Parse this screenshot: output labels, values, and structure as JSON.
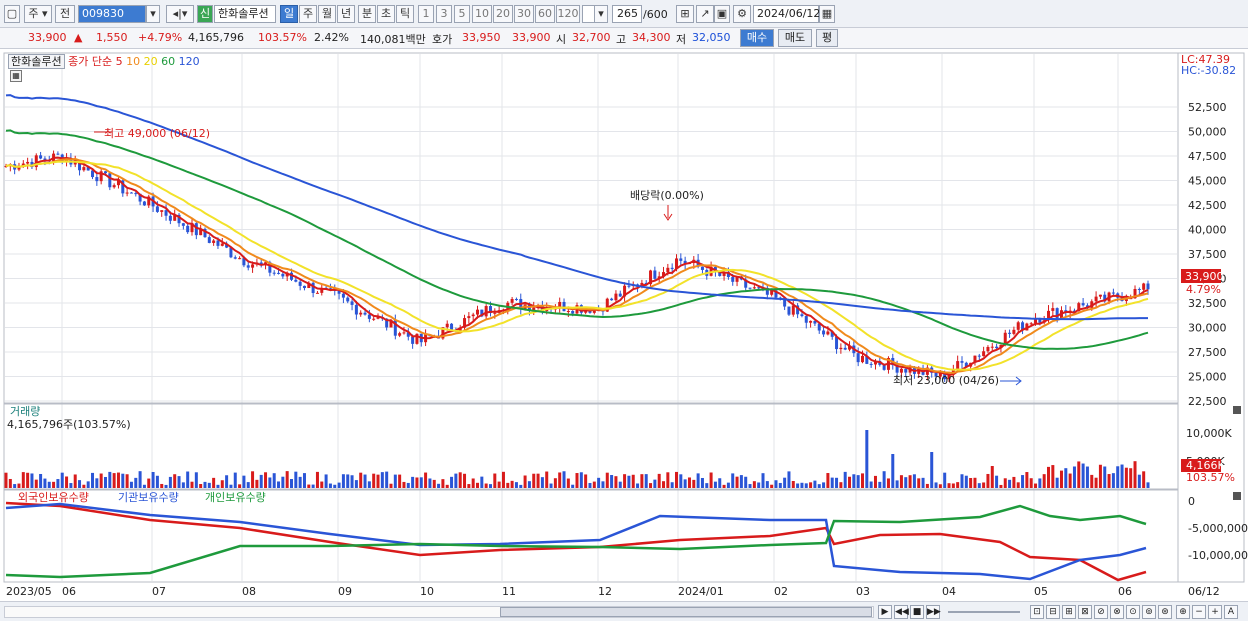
{
  "toolbar": {
    "market": "주",
    "prev": "전",
    "code": "009830",
    "credit": "신",
    "stock_name": "한화솔루션",
    "periods": [
      "일",
      "주",
      "월",
      "년",
      "분",
      "초",
      "틱"
    ],
    "active_period": "일",
    "nums": [
      "1",
      "3",
      "5",
      "10",
      "20",
      "30",
      "60",
      "120"
    ],
    "count": "265",
    "total": "/600",
    "date": "2024/06/12"
  },
  "priceline": {
    "price": "33,900",
    "change": "1,550",
    "change_pct": "+4.79%",
    "volume": "4,165,796",
    "vol_ratio": "103.57%",
    "turnover": "2.42%",
    "amount": "140,081백만",
    "quote_label": "호가",
    "ask": "33,950",
    "bid": "33,900",
    "open_label": "시",
    "open": "32,700",
    "high_label": "고",
    "high": "34,300",
    "low_label": "저",
    "low": "32,050",
    "buy": "매수",
    "sell": "매도",
    "eval": "평"
  },
  "legend": {
    "name": "한화솔루션",
    "ma_label": "종가 단순",
    "ma_periods": [
      "5",
      "10",
      "20",
      "60",
      "120"
    ],
    "ma_colors": [
      "#d81b1b",
      "#f08a1c",
      "#f2e22a",
      "#1e9a3c",
      "#2a55d6"
    ],
    "lc": "LC:47.39",
    "hc": "HC:-30.82"
  },
  "annotations": {
    "high": "최고 49,000 (06/12)",
    "dividend": "배당락(0.00%)",
    "low": "최저 23,000 (04/26)"
  },
  "volume_panel": {
    "title": "거래량",
    "value": "4,165,796주(103.57%)",
    "ticks": [
      "10,000K",
      "5,000K"
    ],
    "last_value": "4,166K",
    "last_pct": "103.57%"
  },
  "holding_panel": {
    "legend": [
      "외국인보유수량",
      "기관보유수량",
      "개인보유수량"
    ],
    "colors": [
      "#d81b1b",
      "#2a55d6",
      "#1e9a3c"
    ],
    "ticks": [
      "0",
      "-5,000,000",
      "-10,000,00"
    ]
  },
  "x_axis": {
    "labels": [
      "2023/05",
      "06",
      "07",
      "08",
      "09",
      "10",
      "11",
      "12",
      "2024/01",
      "02",
      "03",
      "04",
      "05",
      "06",
      "06/12"
    ]
  },
  "chart_data": {
    "type": "line",
    "title": "",
    "y_ticks": [
      "52,500",
      "50,000",
      "47,500",
      "45,000",
      "42,500",
      "40,000",
      "37,500",
      "35,000",
      "32,500",
      "30,000",
      "27,500",
      "25,000",
      "22,500"
    ],
    "last_price": "33,900",
    "last_pct": "4.79%",
    "close_monthly": [
      {
        "x": "2023/05",
        "close": 46500
      },
      {
        "x": "06",
        "close": 47500
      },
      {
        "x": "07",
        "close": 42500
      },
      {
        "x": "08",
        "close": 37000
      },
      {
        "x": "09",
        "close": 33000
      },
      {
        "x": "10",
        "close": 28500
      },
      {
        "x": "11",
        "close": 32500
      },
      {
        "x": "12",
        "close": 32000
      },
      {
        "x": "2024/01",
        "close": 37000
      },
      {
        "x": "02",
        "close": 33000
      },
      {
        "x": "03",
        "close": 27000
      },
      {
        "x": "04",
        "close": 25000
      },
      {
        "x": "05",
        "close": 31000
      },
      {
        "x": "06",
        "close": 33900
      }
    ]
  }
}
